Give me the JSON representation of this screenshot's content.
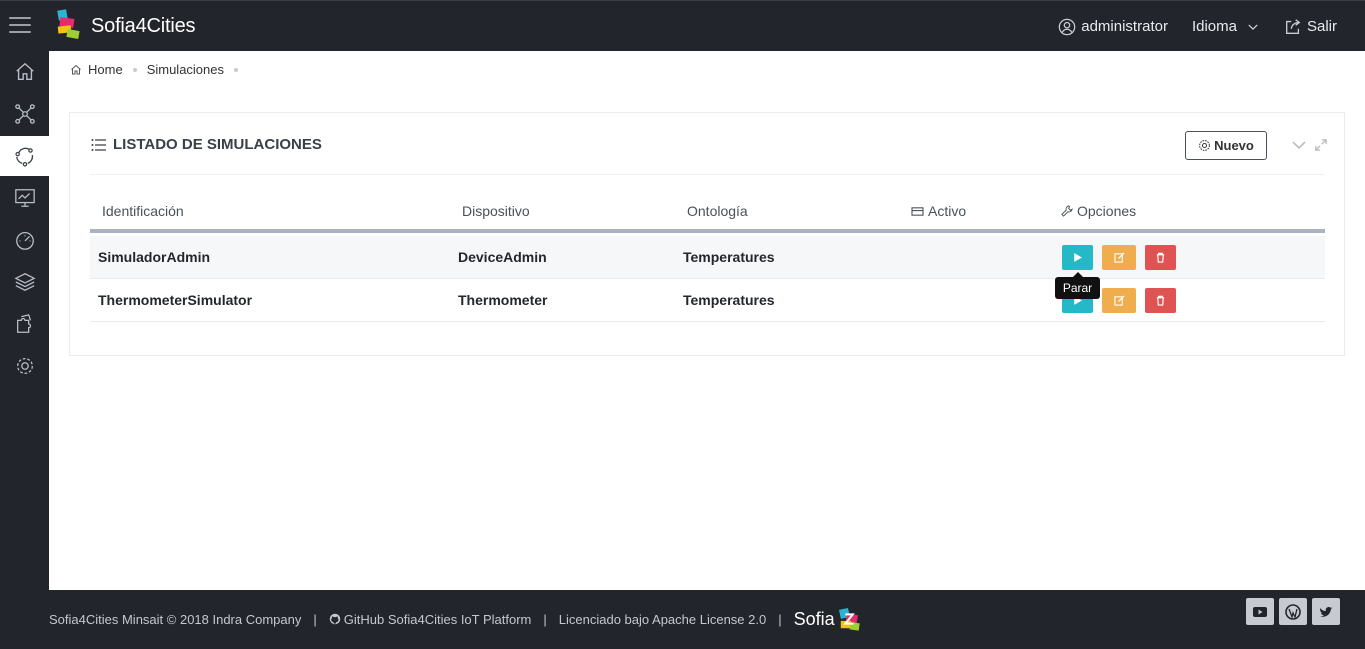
{
  "header": {
    "brand": "Sofia4Cities",
    "user": "administrator",
    "language": "Idioma",
    "logout": "Salir"
  },
  "sidebar": {
    "items": [
      {
        "name": "home-icon"
      },
      {
        "name": "devices-network-icon"
      },
      {
        "name": "simulations-cycle-icon",
        "active": true
      },
      {
        "name": "dashboard-monitor-icon"
      },
      {
        "name": "gauge-icon"
      },
      {
        "name": "layers-icon"
      },
      {
        "name": "puzzle-icon"
      },
      {
        "name": "settings-gear-icon"
      }
    ]
  },
  "breadcrumb": {
    "home": "Home",
    "current": "Simulaciones"
  },
  "portlet": {
    "title": "LISTADO DE SIMULACIONES",
    "new_button": "Nuevo"
  },
  "table": {
    "headers": {
      "identificacion": "Identificación",
      "dispositivo": "Dispositivo",
      "ontologia": "Ontología",
      "activo": "Activo",
      "opciones": "Opciones"
    },
    "rows": [
      {
        "id": "SimuladorAdmin",
        "device": "DeviceAdmin",
        "ontology": "Temperatures",
        "active": ""
      },
      {
        "id": "ThermometerSimulator",
        "device": "Thermometer",
        "ontology": "Temperatures",
        "active": ""
      }
    ]
  },
  "tooltip": "Parar",
  "footer": {
    "copyright": "Sofia4Cities Minsait © 2018 Indra Company",
    "github": "GitHub Sofia4Cities IoT Platform",
    "license": "Licenciado bajo Apache License 2.0",
    "sofia": "Sofia"
  },
  "colors": {
    "dark": "#22252b",
    "play": "#25b8c6",
    "edit": "#f0ad4e",
    "delete": "#e05353"
  }
}
